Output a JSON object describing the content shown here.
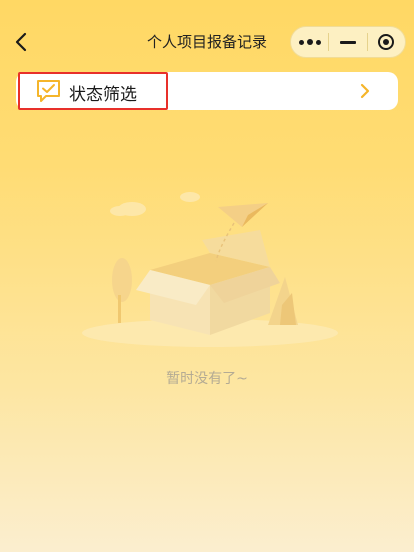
{
  "nav": {
    "title": "个人项目报备记录",
    "back_icon": "chevron-left-icon",
    "capsule": {
      "more_icon": "more-dots-icon",
      "minimize_icon": "minimize-icon",
      "close_icon": "target-circle-icon"
    }
  },
  "filter": {
    "label": "状态筛选",
    "icon": "checked-message-icon",
    "chevron_icon": "chevron-right-icon",
    "accent_color": "#f5b52a",
    "highlight_color": "#e8302a"
  },
  "empty_state": {
    "illustration": "empty-box-paper-plane",
    "text": "暂时没有了~"
  },
  "colors": {
    "background_top": "#ffd864",
    "background_bottom": "#fbeecf"
  }
}
